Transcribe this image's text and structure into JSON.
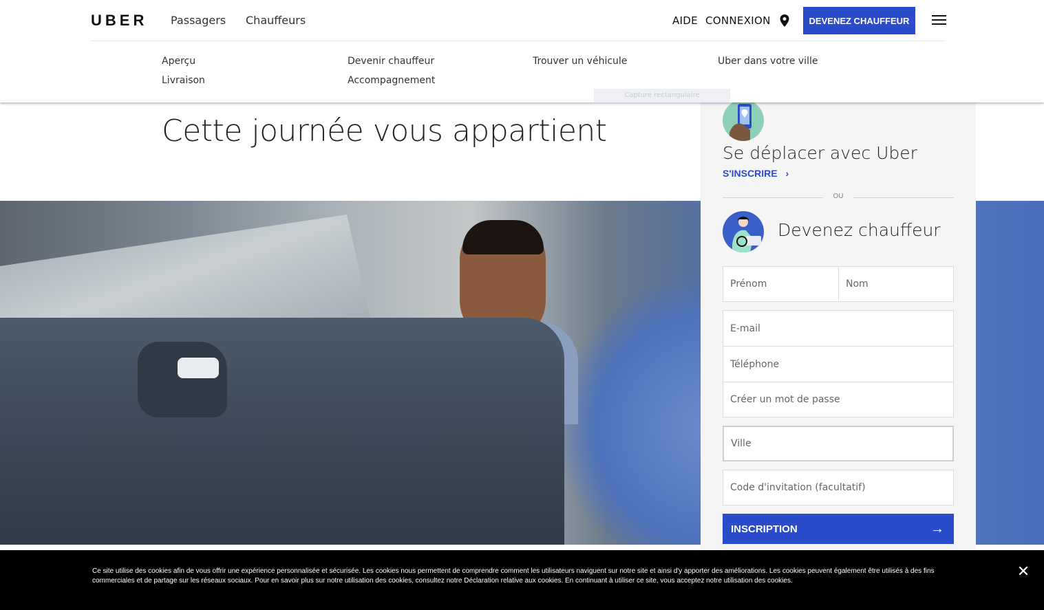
{
  "header": {
    "logo": "UBER",
    "nav": [
      "Passagers",
      "Chauffeurs"
    ],
    "help": "AIDE",
    "login": "CONNEXION",
    "cta": "DEVENEZ CHAUFFEUR"
  },
  "submenu": {
    "items": [
      "Aperçu",
      "Livraison",
      "Devenir chauffeur",
      "Accompagnement",
      "Trouver un véhicule",
      "Uber dans votre ville"
    ],
    "overlay_label": "Capture rectangulaire"
  },
  "hero": {
    "title": "Cette journée vous appartient"
  },
  "panel": {
    "rider_title": "Se déplacer avec Uber",
    "rider_signup": "S'INSCRIRE",
    "or": "OU",
    "driver_title": "Devenez chauffeur",
    "fields": {
      "first_name": "Prénom",
      "last_name": "Nom",
      "email": "E-mail",
      "phone": "Téléphone",
      "password": "Créer un mot de passe",
      "city": "Ville",
      "invite": "Code d'invitation (facultatif)"
    },
    "submit": "INSCRIPTION"
  },
  "cookie": {
    "text": "Ce site utilise des cookies afin de vous offrir une expérience personnalisée et sécurisée. Les cookies nous permettent de comprendre comment les utilisateurs naviguent sur notre site et ainsi d'y apporter des améliorations. Les cookies peuvent également être utilisés à des fins commerciales et de partage sur les réseaux sociaux. Pour en savoir plus sur notre utilisation des cookies, consultez notre Déclaration relative aux cookies. En continuant à utiliser ce site, vous acceptez notre utilisation des cookies."
  },
  "colors": {
    "brand_blue": "#2a4ccb",
    "cookie_bg": "#000000",
    "panel_bg": "#f5f5f5"
  }
}
